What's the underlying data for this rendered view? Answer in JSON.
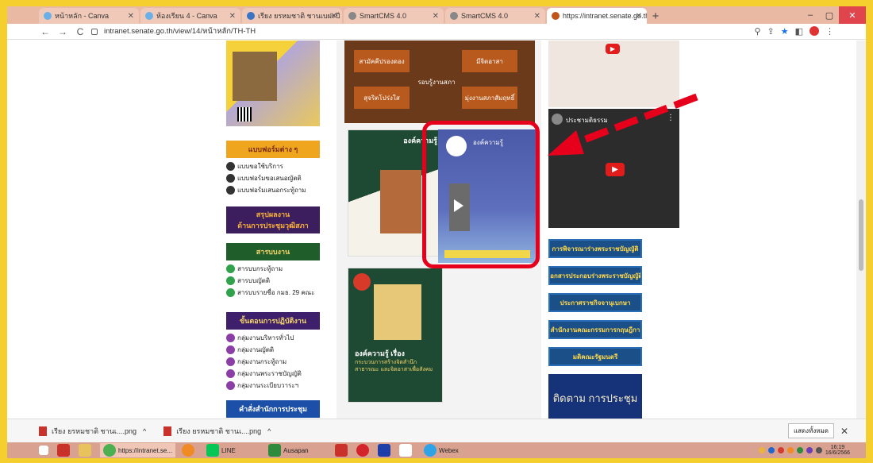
{
  "browser": {
    "tabs": [
      {
        "label": "หน้าหลัก - Canva",
        "color": "#6ab0e8"
      },
      {
        "label": "ห้องเรียน 4 - Canva",
        "color": "#6ab0e8"
      },
      {
        "label": "เรียง ยรหมชาติ ชานเบฝะปี หทัย",
        "color": "#3b74c4"
      },
      {
        "label": "SmartCMS 4.0",
        "color": "#888"
      },
      {
        "label": "SmartCMS 4.0",
        "color": "#888"
      },
      {
        "label": "https://intranet.senate.go.th/vie",
        "color": "#c2531b"
      }
    ],
    "new_tab": "+",
    "url": "intranet.senate.go.th/view/14/หน้าหลัก/TH-TH",
    "back": "←",
    "forward": "→",
    "reload": "C",
    "minimize": "–",
    "maximize": "▢",
    "close": "✕"
  },
  "left": {
    "banner_forms": "แบบฟอร์มต่าง ๆ",
    "forms": [
      "แบบขอใช้บริการ",
      "แบบฟอร์มขอเสนอญัตติ",
      "แบบฟอร์มเสนอกระทู้ถาม"
    ],
    "banner_summary_1": "สรุปผลงาน",
    "banner_summary_2": "ด้านการประชุมวุฒิสภา",
    "banner_catalog": "สารบบงาน",
    "catalogs": [
      "สารบบกระทู้ถาม",
      "สารบบญัตติ",
      "สารบบรายชื่อ กมธ. 29 คณะ"
    ],
    "banner_procedure": "ขั้นตอนการปฏิบัติงาน",
    "procedures": [
      "กลุ่มงานบริหารทั่วไป",
      "กลุ่มงานญัตติ",
      "กลุ่มงานกระทู้ถาม",
      "กลุ่มงานพระราชบัญญัติ",
      "กลุ่มงานระเบียบวาระฯ"
    ],
    "banner_orders": "คำสั่งสำนักการประชุม"
  },
  "middle": {
    "tiles": [
      "สามัคคีปรองดอง",
      "มีจิตอาสา",
      "รอบรู้งานสภา",
      "สุจริตโปร่งใส",
      "มุ่งงานสภาสัมฤทธิ์"
    ],
    "card1_title": "องค์ความรู้",
    "card2_title": "องค์ความรู้ เรื่อง",
    "card2_sub": "กระบวนการสร้างจิตสำนึกสาธารณะ และจิตอาสาเพื่อสังคม",
    "highlight_title": "องค์ความรู้"
  },
  "right": {
    "video_title": "ประชามติธรรม",
    "buttons": [
      "การพิจารณาร่างพระราชบัญญัติ",
      "เอกสารประกอบร่างพระราชบัญญัติ",
      "ประกาศราชกิจจานุเบกษา",
      "สำนักงานคณะกรรมการกฤษฎีกา",
      "มติคณะรัฐมนตรี"
    ],
    "follow": "ติดตาม การประชุม"
  },
  "downloads": {
    "items": [
      "เรียง ยรหมชาติ ชานเ....png",
      "เรียง ยรหมชาติ ชานเ....png"
    ],
    "show_all": "แสดงทั้งหมด",
    "close": "✕"
  },
  "taskbar": {
    "apps": [
      "https://intranet.se...",
      "LINE",
      "Ausapan",
      "Webex"
    ],
    "time": "16:19",
    "date": "16/6/2566"
  },
  "colors": {
    "frame": "#f5cf2e",
    "highlight": "#e6001c",
    "arrow": "#e6001c",
    "button_bg": "#1b4f87",
    "button_text": "#ffd94a"
  }
}
